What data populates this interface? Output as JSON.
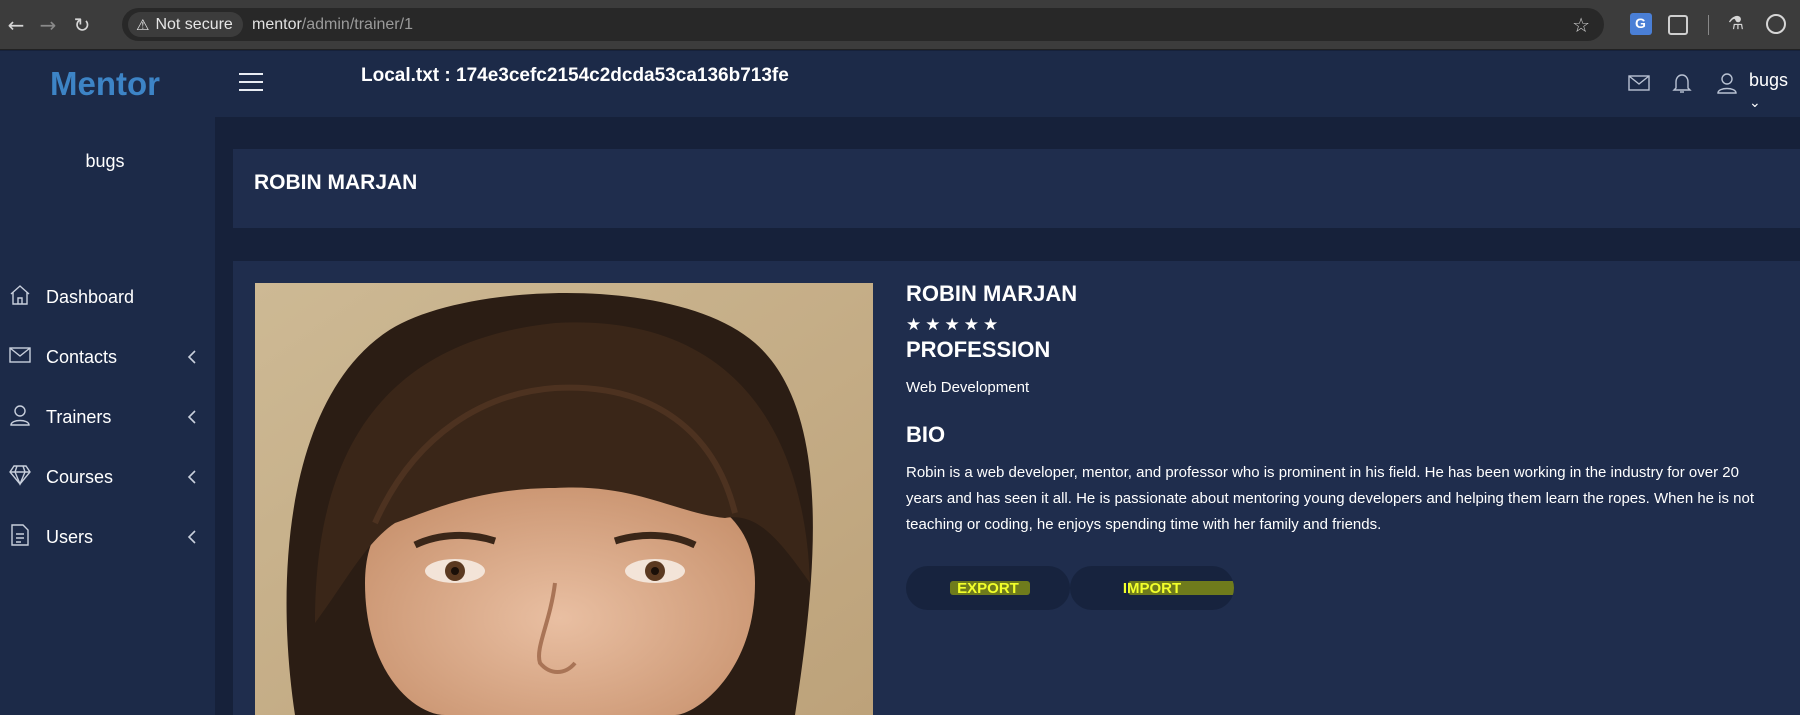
{
  "browser": {
    "security_label": "Not secure",
    "url_host": "mentor",
    "url_path": "/admin/trainer/1"
  },
  "sidebar": {
    "brand": "Mentor",
    "user_name": "bugs",
    "items": [
      {
        "label": "Dashboard",
        "icon": "home-icon",
        "expandable": false
      },
      {
        "label": "Contacts",
        "icon": "envelope-icon",
        "expandable": true
      },
      {
        "label": "Trainers",
        "icon": "user-icon",
        "expandable": true
      },
      {
        "label": "Courses",
        "icon": "diamond-icon",
        "expandable": true
      },
      {
        "label": "Users",
        "icon": "document-icon",
        "expandable": true
      }
    ]
  },
  "header": {
    "local_txt": "Local.txt : 174e3cefc2154c2dcda53ca136b713fe",
    "user_name": "bugs"
  },
  "page": {
    "title": "ROBIN MARJAN"
  },
  "trainer": {
    "name": "ROBIN MARJAN",
    "rating": 5,
    "stars": [
      "★",
      "★",
      "★",
      "★",
      "★"
    ],
    "profession_heading": "PROFESSION",
    "profession": "Web Development",
    "bio_heading": "BIO",
    "bio": "Robin is a web developer, mentor, and professor who is prominent in his field. He has been working in the industry for over 20 years and has seen it all. He is passionate about mentoring young developers and helping them learn the ropes. When he is not teaching or coding, he enjoys spending time with her family and friends.",
    "export_label": "EXPORT",
    "import_label": "IMPORT"
  },
  "colors": {
    "brand": "#3d84c6",
    "background": "#16213a",
    "panel": "#1f2d4d",
    "sidebar": "#1c2a48",
    "highlight": "#f2ff2a"
  }
}
